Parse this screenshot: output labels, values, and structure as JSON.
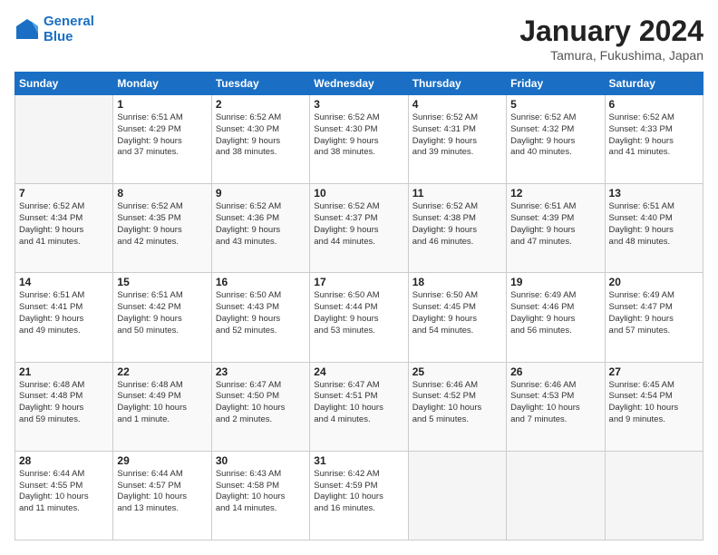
{
  "logo": {
    "line1": "General",
    "line2": "Blue"
  },
  "header": {
    "month": "January 2024",
    "location": "Tamura, Fukushima, Japan"
  },
  "days_of_week": [
    "Sunday",
    "Monday",
    "Tuesday",
    "Wednesday",
    "Thursday",
    "Friday",
    "Saturday"
  ],
  "weeks": [
    [
      {
        "day": "",
        "info": ""
      },
      {
        "day": "1",
        "info": "Sunrise: 6:51 AM\nSunset: 4:29 PM\nDaylight: 9 hours\nand 37 minutes."
      },
      {
        "day": "2",
        "info": "Sunrise: 6:52 AM\nSunset: 4:30 PM\nDaylight: 9 hours\nand 38 minutes."
      },
      {
        "day": "3",
        "info": "Sunrise: 6:52 AM\nSunset: 4:30 PM\nDaylight: 9 hours\nand 38 minutes."
      },
      {
        "day": "4",
        "info": "Sunrise: 6:52 AM\nSunset: 4:31 PM\nDaylight: 9 hours\nand 39 minutes."
      },
      {
        "day": "5",
        "info": "Sunrise: 6:52 AM\nSunset: 4:32 PM\nDaylight: 9 hours\nand 40 minutes."
      },
      {
        "day": "6",
        "info": "Sunrise: 6:52 AM\nSunset: 4:33 PM\nDaylight: 9 hours\nand 41 minutes."
      }
    ],
    [
      {
        "day": "7",
        "info": "Sunrise: 6:52 AM\nSunset: 4:34 PM\nDaylight: 9 hours\nand 41 minutes."
      },
      {
        "day": "8",
        "info": "Sunrise: 6:52 AM\nSunset: 4:35 PM\nDaylight: 9 hours\nand 42 minutes."
      },
      {
        "day": "9",
        "info": "Sunrise: 6:52 AM\nSunset: 4:36 PM\nDaylight: 9 hours\nand 43 minutes."
      },
      {
        "day": "10",
        "info": "Sunrise: 6:52 AM\nSunset: 4:37 PM\nDaylight: 9 hours\nand 44 minutes."
      },
      {
        "day": "11",
        "info": "Sunrise: 6:52 AM\nSunset: 4:38 PM\nDaylight: 9 hours\nand 46 minutes."
      },
      {
        "day": "12",
        "info": "Sunrise: 6:51 AM\nSunset: 4:39 PM\nDaylight: 9 hours\nand 47 minutes."
      },
      {
        "day": "13",
        "info": "Sunrise: 6:51 AM\nSunset: 4:40 PM\nDaylight: 9 hours\nand 48 minutes."
      }
    ],
    [
      {
        "day": "14",
        "info": "Sunrise: 6:51 AM\nSunset: 4:41 PM\nDaylight: 9 hours\nand 49 minutes."
      },
      {
        "day": "15",
        "info": "Sunrise: 6:51 AM\nSunset: 4:42 PM\nDaylight: 9 hours\nand 50 minutes."
      },
      {
        "day": "16",
        "info": "Sunrise: 6:50 AM\nSunset: 4:43 PM\nDaylight: 9 hours\nand 52 minutes."
      },
      {
        "day": "17",
        "info": "Sunrise: 6:50 AM\nSunset: 4:44 PM\nDaylight: 9 hours\nand 53 minutes."
      },
      {
        "day": "18",
        "info": "Sunrise: 6:50 AM\nSunset: 4:45 PM\nDaylight: 9 hours\nand 54 minutes."
      },
      {
        "day": "19",
        "info": "Sunrise: 6:49 AM\nSunset: 4:46 PM\nDaylight: 9 hours\nand 56 minutes."
      },
      {
        "day": "20",
        "info": "Sunrise: 6:49 AM\nSunset: 4:47 PM\nDaylight: 9 hours\nand 57 minutes."
      }
    ],
    [
      {
        "day": "21",
        "info": "Sunrise: 6:48 AM\nSunset: 4:48 PM\nDaylight: 9 hours\nand 59 minutes."
      },
      {
        "day": "22",
        "info": "Sunrise: 6:48 AM\nSunset: 4:49 PM\nDaylight: 10 hours\nand 1 minute."
      },
      {
        "day": "23",
        "info": "Sunrise: 6:47 AM\nSunset: 4:50 PM\nDaylight: 10 hours\nand 2 minutes."
      },
      {
        "day": "24",
        "info": "Sunrise: 6:47 AM\nSunset: 4:51 PM\nDaylight: 10 hours\nand 4 minutes."
      },
      {
        "day": "25",
        "info": "Sunrise: 6:46 AM\nSunset: 4:52 PM\nDaylight: 10 hours\nand 5 minutes."
      },
      {
        "day": "26",
        "info": "Sunrise: 6:46 AM\nSunset: 4:53 PM\nDaylight: 10 hours\nand 7 minutes."
      },
      {
        "day": "27",
        "info": "Sunrise: 6:45 AM\nSunset: 4:54 PM\nDaylight: 10 hours\nand 9 minutes."
      }
    ],
    [
      {
        "day": "28",
        "info": "Sunrise: 6:44 AM\nSunset: 4:55 PM\nDaylight: 10 hours\nand 11 minutes."
      },
      {
        "day": "29",
        "info": "Sunrise: 6:44 AM\nSunset: 4:57 PM\nDaylight: 10 hours\nand 13 minutes."
      },
      {
        "day": "30",
        "info": "Sunrise: 6:43 AM\nSunset: 4:58 PM\nDaylight: 10 hours\nand 14 minutes."
      },
      {
        "day": "31",
        "info": "Sunrise: 6:42 AM\nSunset: 4:59 PM\nDaylight: 10 hours\nand 16 minutes."
      },
      {
        "day": "",
        "info": ""
      },
      {
        "day": "",
        "info": ""
      },
      {
        "day": "",
        "info": ""
      }
    ]
  ]
}
